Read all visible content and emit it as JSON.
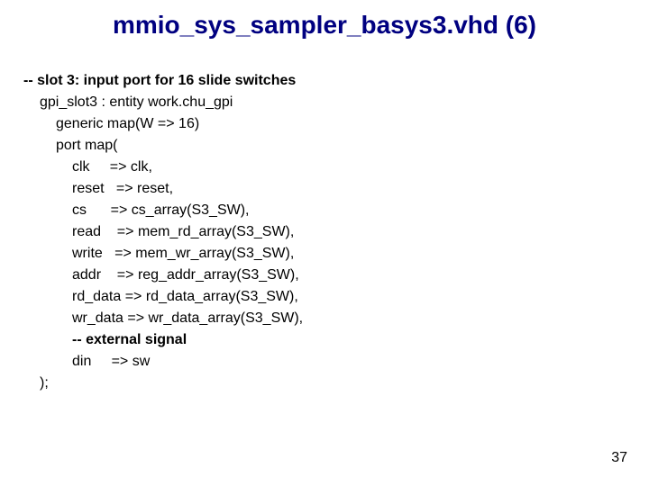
{
  "title": "mmio_sys_sampler_basys3.vhd (6)",
  "code": {
    "comment_slot": "-- slot 3: input port for 16 slide switches",
    "inst": "gpi_slot3 : entity work.chu_gpi",
    "generic": "generic map(W => 16)",
    "portmap": "port map(",
    "clk": "clk     => clk,",
    "reset": "reset   => reset,",
    "cs": "cs      => cs_array(S3_SW),",
    "read": "read    => mem_rd_array(S3_SW),",
    "write": "write   => mem_wr_array(S3_SW),",
    "addr": "addr    => reg_addr_array(S3_SW),",
    "rd_data": "rd_data => rd_data_array(S3_SW),",
    "wr_data": "wr_data => wr_data_array(S3_SW),",
    "ext_comment": "-- external signal",
    "din": "din     => sw",
    "close": ");"
  },
  "page_number": "37"
}
